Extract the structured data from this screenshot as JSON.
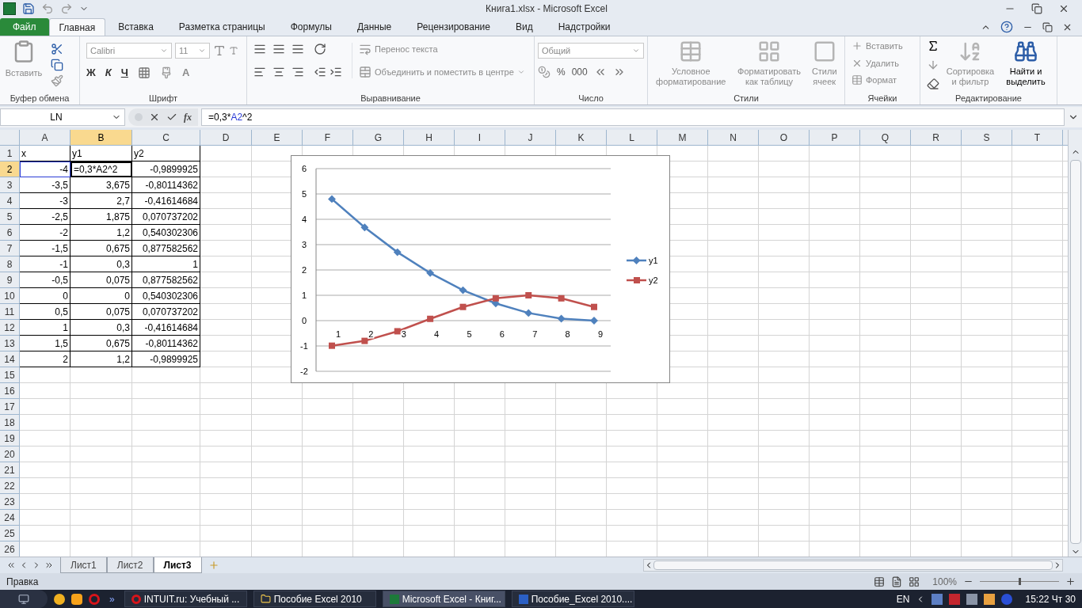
{
  "window": {
    "title": "Книга1.xlsx - Microsoft Excel"
  },
  "tabs": [
    {
      "label": "Файл",
      "kind": "file",
      "selected": false
    },
    {
      "label": "Главная",
      "kind": "tab",
      "selected": true
    },
    {
      "label": "Вставка",
      "kind": "tab",
      "selected": false
    },
    {
      "label": "Разметка страницы",
      "kind": "tab",
      "selected": false
    },
    {
      "label": "Формулы",
      "kind": "tab",
      "selected": false
    },
    {
      "label": "Данные",
      "kind": "tab",
      "selected": false
    },
    {
      "label": "Рецензирование",
      "kind": "tab",
      "selected": false
    },
    {
      "label": "Вид",
      "kind": "tab",
      "selected": false
    },
    {
      "label": "Надстройки",
      "kind": "tab",
      "selected": false
    }
  ],
  "ribbon": [
    {
      "label": "Буфер обмена",
      "kind": "clipboard",
      "items": [
        {
          "label": "Вставить",
          "disabled": true
        }
      ]
    },
    {
      "label": "Шрифт",
      "kind": "font",
      "font": "Calibri",
      "size": "11",
      "items": [
        {
          "label": "Ж",
          "disabled": false
        },
        {
          "label": "К",
          "disabled": false
        },
        {
          "label": "Ч",
          "disabled": false
        },
        {
          "label": "А",
          "disabled": true
        }
      ]
    },
    {
      "label": "Выравнивание",
      "kind": "alignment",
      "items": [
        {
          "label": "Перенос текста",
          "disabled": true
        },
        {
          "label": "Объединить и поместить в центре",
          "disabled": true
        }
      ]
    },
    {
      "label": "Число",
      "kind": "number",
      "format": "Общий",
      "items": [
        {
          "label": "%",
          "disabled": false
        },
        {
          "label": "000",
          "disabled": false
        }
      ]
    },
    {
      "label": "Стили",
      "kind": "styles",
      "items": [
        {
          "label": "Условное форматирование",
          "disabled": true
        },
        {
          "label": "Форматировать как таблицу",
          "disabled": true
        },
        {
          "label": "Стили ячеек",
          "disabled": true
        }
      ]
    },
    {
      "label": "Ячейки",
      "kind": "cells",
      "items": [
        {
          "label": "Вставить",
          "disabled": true
        },
        {
          "label": "Удалить",
          "disabled": true
        },
        {
          "label": "Формат",
          "disabled": true
        }
      ]
    },
    {
      "label": "Редактирование",
      "kind": "editing",
      "items": [
        {
          "label": "Сортировка и фильтр",
          "disabled": true
        },
        {
          "label": "Найти и выделить",
          "disabled": false
        }
      ]
    }
  ],
  "formula_bar": {
    "name_box": "LN",
    "function_label": "fx",
    "parts": [
      {
        "text": "=0,3",
        "kind": "plain"
      },
      {
        "text": "*",
        "kind": "plain"
      },
      {
        "text": "A2",
        "kind": "ref"
      },
      {
        "text": "^2",
        "kind": "plain"
      }
    ]
  },
  "columns": [
    {
      "label": "A",
      "selected": false
    },
    {
      "label": "B",
      "selected": true
    },
    {
      "label": "C",
      "selected": false
    },
    {
      "label": "D",
      "selected": false
    },
    {
      "label": "E",
      "selected": false
    },
    {
      "label": "F",
      "selected": false
    },
    {
      "label": "G",
      "selected": false
    },
    {
      "label": "H",
      "selected": false
    },
    {
      "label": "I",
      "selected": false
    },
    {
      "label": "J",
      "selected": false
    },
    {
      "label": "K",
      "selected": false
    },
    {
      "label": "L",
      "selected": false
    },
    {
      "label": "M",
      "selected": false
    },
    {
      "label": "N",
      "selected": false
    },
    {
      "label": "O",
      "selected": false
    },
    {
      "label": "P",
      "selected": false
    },
    {
      "label": "Q",
      "selected": false
    },
    {
      "label": "R",
      "selected": false
    },
    {
      "label": "S",
      "selected": false
    },
    {
      "label": "T",
      "selected": false
    }
  ],
  "rows": [
    {
      "label": "1",
      "selected": false,
      "cells": [
        {
          "text": "x",
          "kind": "label"
        },
        {
          "text": "y1",
          "kind": "label"
        },
        {
          "text": "y2",
          "kind": "label"
        }
      ]
    },
    {
      "label": "2",
      "selected": true,
      "cells": [
        {
          "text": "-4",
          "kind": "reference"
        },
        {
          "text": "=0,3*A2^2",
          "kind": "editing"
        },
        {
          "text": "-0,9899925",
          "kind": "number"
        }
      ]
    },
    {
      "label": "3",
      "selected": false,
      "cells": [
        {
          "text": "-3,5",
          "kind": "number"
        },
        {
          "text": "3,675",
          "kind": "number"
        },
        {
          "text": "-0,80114362",
          "kind": "number"
        }
      ]
    },
    {
      "label": "4",
      "selected": false,
      "cells": [
        {
          "text": "-3",
          "kind": "number"
        },
        {
          "text": "2,7",
          "kind": "number"
        },
        {
          "text": "-0,41614684",
          "kind": "number"
        }
      ]
    },
    {
      "label": "5",
      "selected": false,
      "cells": [
        {
          "text": "-2,5",
          "kind": "number"
        },
        {
          "text": "1,875",
          "kind": "number"
        },
        {
          "text": "0,070737202",
          "kind": "number"
        }
      ]
    },
    {
      "label": "6",
      "selected": false,
      "cells": [
        {
          "text": "-2",
          "kind": "number"
        },
        {
          "text": "1,2",
          "kind": "number"
        },
        {
          "text": "0,540302306",
          "kind": "number"
        }
      ]
    },
    {
      "label": "7",
      "selected": false,
      "cells": [
        {
          "text": "-1,5",
          "kind": "number"
        },
        {
          "text": "0,675",
          "kind": "number"
        },
        {
          "text": "0,877582562",
          "kind": "number"
        }
      ]
    },
    {
      "label": "8",
      "selected": false,
      "cells": [
        {
          "text": "-1",
          "kind": "number"
        },
        {
          "text": "0,3",
          "kind": "number"
        },
        {
          "text": "1",
          "kind": "number"
        }
      ]
    },
    {
      "label": "9",
      "selected": false,
      "cells": [
        {
          "text": "-0,5",
          "kind": "number"
        },
        {
          "text": "0,075",
          "kind": "number"
        },
        {
          "text": "0,877582562",
          "kind": "number"
        }
      ]
    },
    {
      "label": "10",
      "selected": false,
      "cells": [
        {
          "text": "0",
          "kind": "number"
        },
        {
          "text": "0",
          "kind": "number"
        },
        {
          "text": "0,540302306",
          "kind": "number"
        }
      ]
    },
    {
      "label": "11",
      "selected": false,
      "cells": [
        {
          "text": "0,5",
          "kind": "number"
        },
        {
          "text": "0,075",
          "kind": "number"
        },
        {
          "text": "0,070737202",
          "kind": "number"
        }
      ]
    },
    {
      "label": "12",
      "selected": false,
      "cells": [
        {
          "text": "1",
          "kind": "number"
        },
        {
          "text": "0,3",
          "kind": "number"
        },
        {
          "text": "-0,41614684",
          "kind": "number"
        }
      ]
    },
    {
      "label": "13",
      "selected": false,
      "cells": [
        {
          "text": "1,5",
          "kind": "number"
        },
        {
          "text": "0,675",
          "kind": "number"
        },
        {
          "text": "-0,80114362",
          "kind": "number"
        }
      ]
    },
    {
      "label": "14",
      "selected": false,
      "cells": [
        {
          "text": "2",
          "kind": "number"
        },
        {
          "text": "1,2",
          "kind": "number"
        },
        {
          "text": "-0,9899925",
          "kind": "number"
        }
      ]
    },
    {
      "label": "15",
      "selected": false
    },
    {
      "label": "16",
      "selected": false
    },
    {
      "label": "17",
      "selected": false
    },
    {
      "label": "18",
      "selected": false
    },
    {
      "label": "19",
      "selected": false
    },
    {
      "label": "20",
      "selected": false
    },
    {
      "label": "21",
      "selected": false
    },
    {
      "label": "22",
      "selected": false
    },
    {
      "label": "23",
      "selected": false
    },
    {
      "label": "24",
      "selected": false
    },
    {
      "label": "25",
      "selected": false
    },
    {
      "label": "26",
      "selected": false
    }
  ],
  "chart": {
    "chart_data": {
      "type": "line",
      "categories": [
        "1",
        "2",
        "3",
        "4",
        "5",
        "6",
        "7",
        "8",
        "9"
      ],
      "series": [
        {
          "name": "y1",
          "color": "#4f81bd",
          "marker": "diamond",
          "values": [
            4.8,
            3.68,
            2.7,
            1.88,
            1.2,
            0.68,
            0.3,
            0.08,
            0
          ]
        },
        {
          "name": "y2",
          "color": "#c0504d",
          "marker": "square",
          "values": [
            -0.99,
            -0.8,
            -0.42,
            0.07,
            0.54,
            0.88,
            1,
            0.88,
            0.54
          ]
        }
      ],
      "ylim": [
        -2,
        6
      ],
      "yticks": [
        {
          "value": -2,
          "label": "-2"
        },
        {
          "value": -1,
          "label": "-1"
        },
        {
          "value": 0,
          "label": "0"
        },
        {
          "value": 1,
          "label": "1"
        },
        {
          "value": 2,
          "label": "2"
        },
        {
          "value": 3,
          "label": "3"
        },
        {
          "value": 4,
          "label": "4"
        },
        {
          "value": 5,
          "label": "5"
        },
        {
          "value": 6,
          "label": "6"
        }
      ],
      "grid": true,
      "legend": true
    }
  },
  "sheet_tabs": [
    {
      "label": "Лист1",
      "selected": false
    },
    {
      "label": "Лист2",
      "selected": false
    },
    {
      "label": "Лист3",
      "selected": true
    }
  ],
  "status_bar": {
    "mode": "Правка",
    "zoom": {
      "label": "100%",
      "level": 0.5
    }
  },
  "taskbar": {
    "more": "»",
    "tasks": [
      {
        "label": "INTUIT.ru: Учебный ...",
        "kind": "browser",
        "selected": false
      },
      {
        "label": "Пособие Excel 2010",
        "kind": "folder",
        "selected": false
      },
      {
        "label": "Microsoft Excel - Книг...",
        "kind": "excel",
        "selected": true
      },
      {
        "label": "Пособие_Excel 2010....",
        "kind": "word",
        "selected": false
      }
    ],
    "language": "EN",
    "clock": "15:22 Чт 30"
  }
}
